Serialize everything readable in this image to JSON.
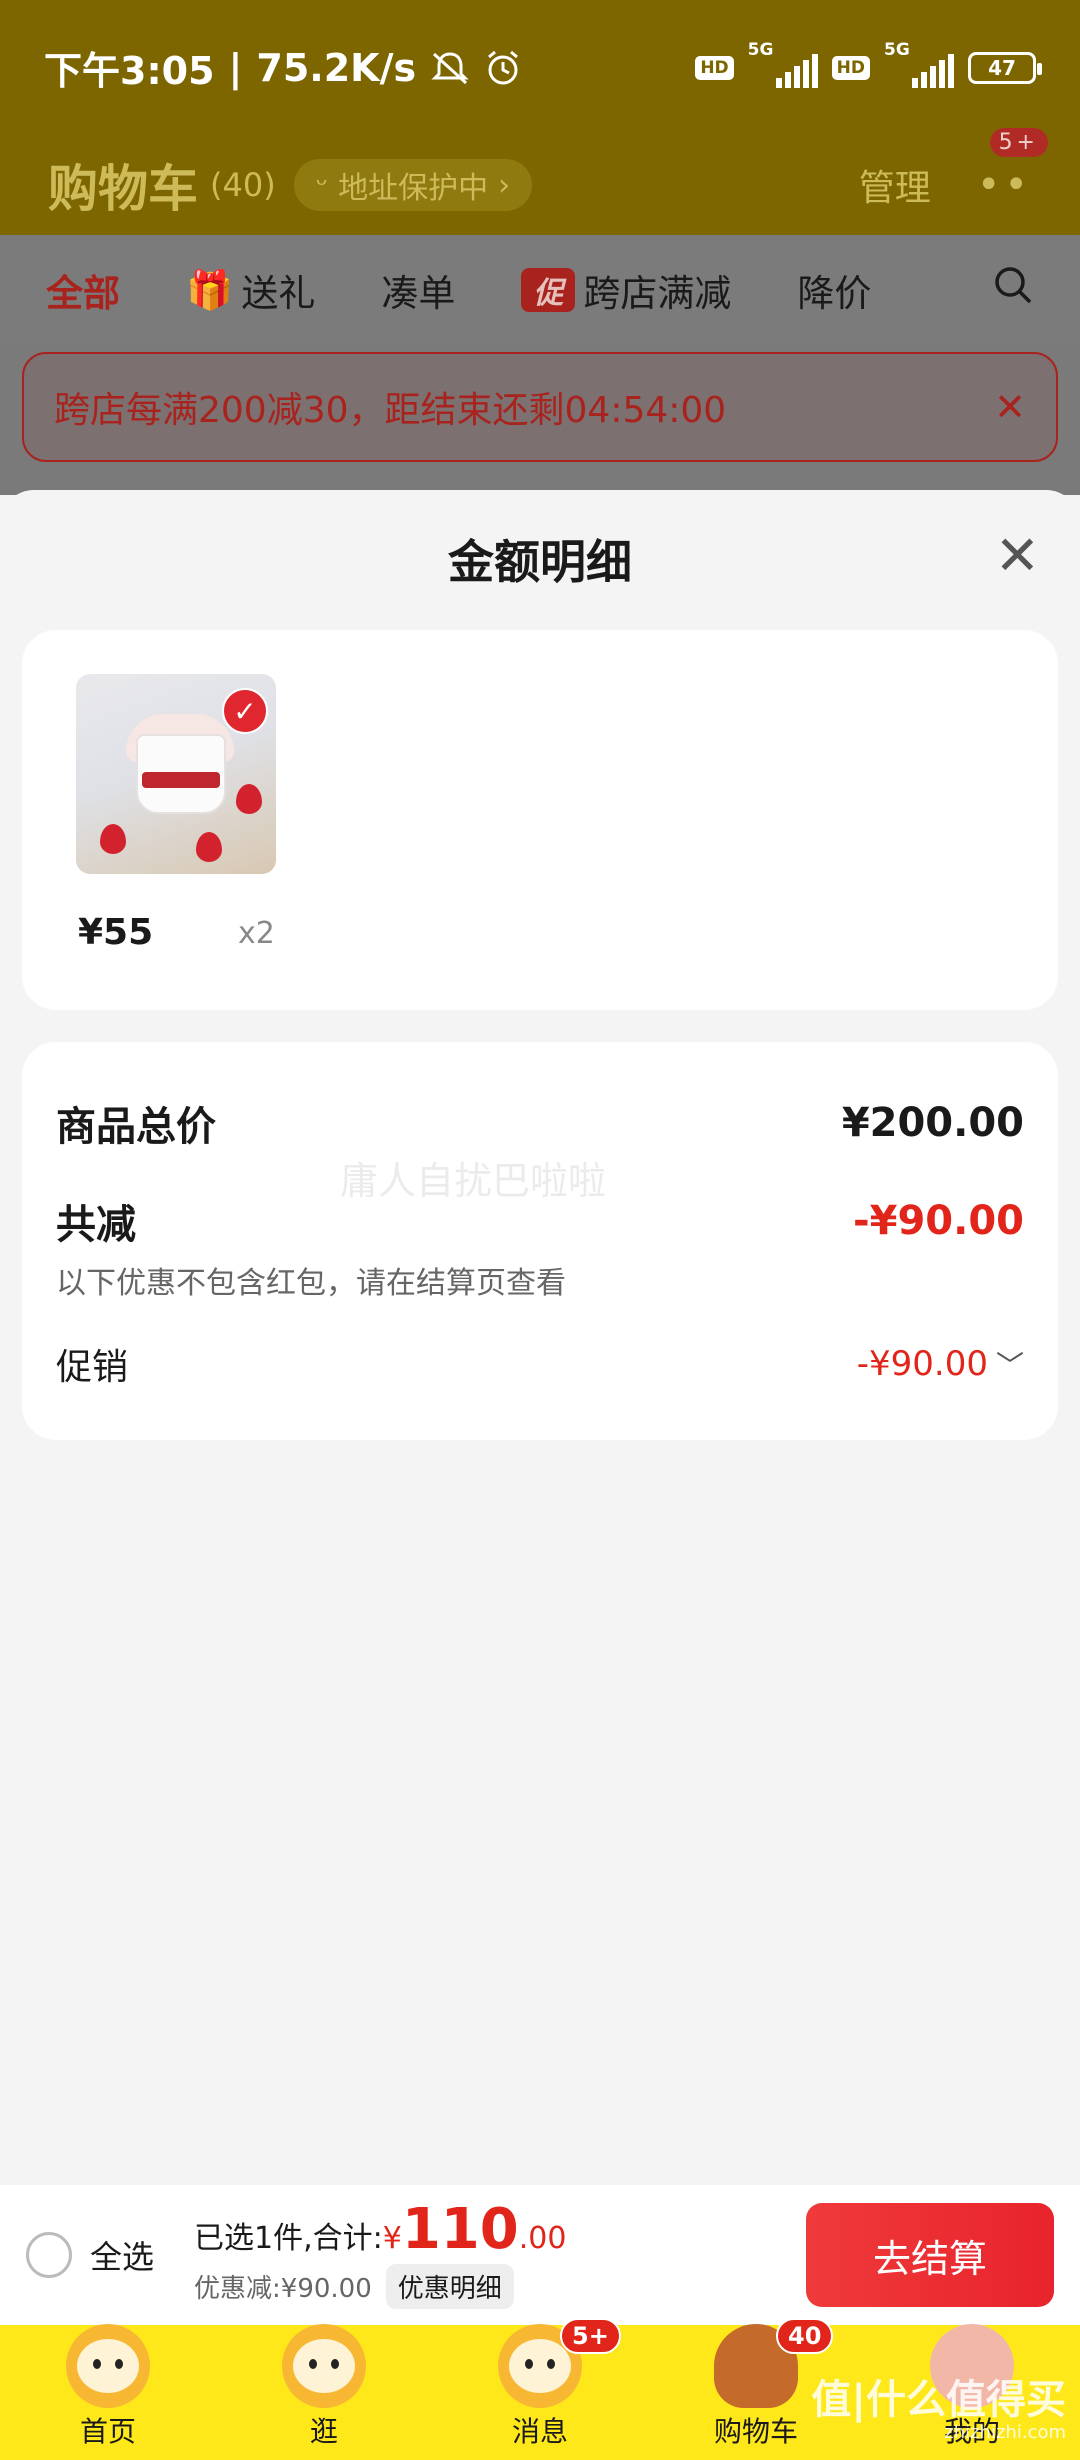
{
  "status_bar": {
    "time": "下午3:05",
    "speed": "75.2K/s",
    "hd1": "HD",
    "net1": "5G",
    "hd2": "HD",
    "net2": "5G",
    "battery": "47"
  },
  "header": {
    "title": "购物车",
    "count": "(40)",
    "address": "地址保护中",
    "manage": "管理",
    "more_badge": "5+"
  },
  "tabs": [
    {
      "label": "全部"
    },
    {
      "label": "送礼"
    },
    {
      "label": "凑单"
    },
    {
      "label": "跨店满减",
      "tag": "促"
    },
    {
      "label": "降价"
    }
  ],
  "promo_banner": {
    "text": "跨店每满200减30，距结束还剩04:54:00"
  },
  "sheet": {
    "title": "金额明细",
    "product": {
      "price": "¥55",
      "qty": "x2"
    },
    "summary": {
      "total_label": "商品总价",
      "total_value": "¥200.00",
      "discount_label": "共减",
      "discount_value": "-¥90.00",
      "note": "以下优惠不包含红包，请在结算页查看",
      "promo_label": "促销",
      "promo_value": "-¥90.00"
    },
    "watermark": "庸人自扰巴啦啦"
  },
  "checkout": {
    "select_all": "全选",
    "selected_prefix": "已选1件,合计:",
    "yen": "¥",
    "amount_int": "110",
    "amount_dec": ".00",
    "discount_text": "优惠减:¥90.00",
    "discount_detail": "优惠明细",
    "pay": "去结算"
  },
  "bottom_nav": {
    "items": [
      {
        "label": "首页"
      },
      {
        "label": "逛"
      },
      {
        "label": "消息",
        "badge": "5+"
      },
      {
        "label": "购物车",
        "badge": "40"
      },
      {
        "label": "我的"
      }
    ]
  },
  "corner_watermark": {
    "main": "值|什么值得买",
    "sub": "zhizhizhi.com"
  },
  "colors": {
    "accent_red": "#e1251b",
    "nav_yellow": "#ffe81a",
    "header_dim": "#7d6600"
  }
}
